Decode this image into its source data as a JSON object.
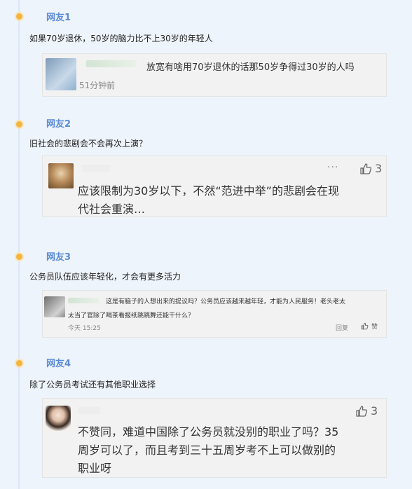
{
  "items": [
    {
      "nick": "网友1",
      "comment": "如果70岁退休，50岁的脑力比不上30岁的年轻人",
      "reply": {
        "text": "放宽有啥用70岁退休的话那50岁争得过30岁的人吗",
        "time": "51分钟前"
      }
    },
    {
      "nick": "网友2",
      "comment": "旧社会的悲剧会不会再次上演？",
      "reply": {
        "more": "···",
        "likes": "3",
        "line1": "应该限制为30岁以下，不然“范进中举”的悲剧会在现",
        "line2": "代社会重演…"
      }
    },
    {
      "nick": "网友3",
      "comment": "公务员队伍应该年轻化，才会有更多活力",
      "reply": {
        "line1": "这是有脑子的人想出来的提议吗？公务员应该越来越年轻，才能为人民服务！老头老太",
        "line2": "太当了官除了喝茶看报纸跳跳舞还能干什么？",
        "time": "今天 15:25",
        "reply_label": "回复",
        "like_label": "赞"
      }
    },
    {
      "nick": "网友4",
      "comment": "除了公务员考试还有其他职业选择",
      "reply": {
        "likes": "3",
        "line1": "不赞同，难道中国除了公务员就没别的职业了吗？35",
        "line2": "周岁可以了，而且考到三十五周岁考不上可以做别的",
        "line3": "职业呀"
      }
    }
  ],
  "colors": {
    "nick": "#5b8bd6",
    "dot": "#f3b53e",
    "card": "#f2f2f2"
  }
}
